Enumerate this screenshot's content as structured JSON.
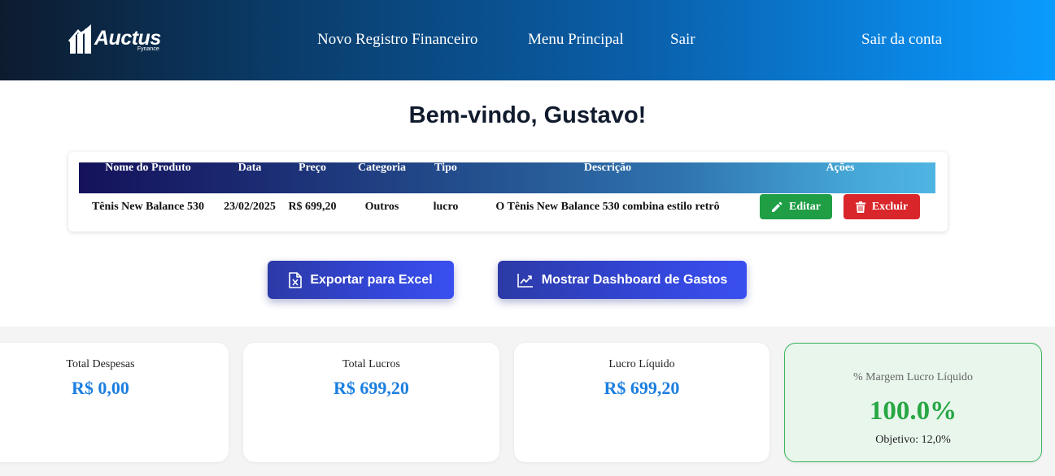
{
  "header": {
    "logo_text": "Auctus",
    "logo_sub": "Fynance",
    "nav": {
      "novo_registro": "Novo Registro Financeiro",
      "menu_principal": "Menu Principal",
      "sair": "Sair",
      "sair_conta": "Sair da conta"
    }
  },
  "welcome": "Bem-vindo, Gustavo!",
  "table": {
    "headers": [
      "Nome do Produto",
      "Data",
      "Preço",
      "Categoria",
      "Tipo",
      "Descrição",
      "Ações"
    ],
    "rows": [
      {
        "nome": "Tênis New Balance 530",
        "data": "23/02/2025",
        "preco": "R$ 699,20",
        "categoria": "Outros",
        "tipo": "lucro",
        "descricao": "O Tênis New Balance 530 combina estilo retrô",
        "editar": "Editar",
        "excluir": "Excluir"
      }
    ]
  },
  "actions": {
    "export_label": "Exportar para Excel",
    "dashboard_label": "Mostrar Dashboard de Gastos"
  },
  "summary": {
    "despesas": {
      "label": "Total Despesas",
      "value": "R$ 0,00"
    },
    "lucros": {
      "label": "Total Lucros",
      "value": "R$ 699,20"
    },
    "liquido": {
      "label": "Lucro Líquido",
      "value": "R$ 699,20"
    },
    "margem": {
      "label": "% Margem Lucro Líquido",
      "value": "100.0%",
      "goal": "Objetivo: 12,0%"
    }
  },
  "colors": {
    "accent_blue": "#1c7fe0",
    "success_green": "#28a745",
    "edit_button": "#1f9e45",
    "delete_button": "#d9262a",
    "action_button": "#3346d8"
  },
  "icons": {
    "logo": "auctus-logo-icon",
    "edit": "pencil-icon",
    "delete": "trash-icon",
    "export": "excel-file-icon",
    "dashboard": "trending-chart-icon"
  }
}
